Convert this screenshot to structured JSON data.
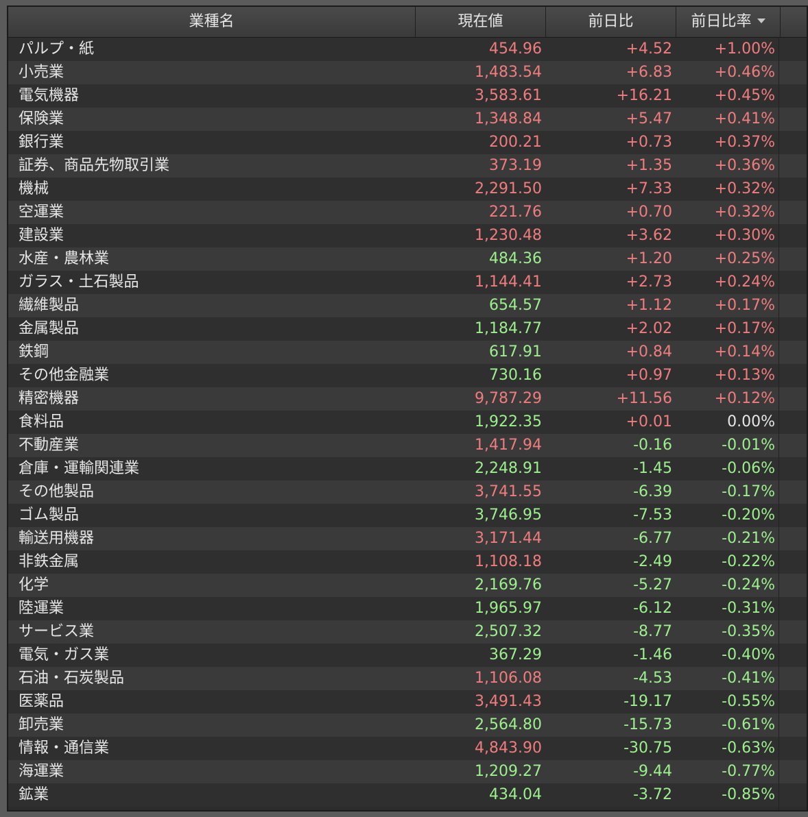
{
  "header": {
    "name": "業種名",
    "price": "現在値",
    "change": "前日比",
    "rate": "前日比率"
  },
  "colors": {
    "up": "#f07d7d",
    "down": "#9df08e",
    "flat": "#e6e6e6"
  },
  "rows": [
    {
      "name": "パルプ・紙",
      "price": "454.96",
      "price_dir": "up",
      "change": "+4.52",
      "change_dir": "up",
      "rate": "+1.00%",
      "rate_dir": "up"
    },
    {
      "name": "小売業",
      "price": "1,483.54",
      "price_dir": "up",
      "change": "+6.83",
      "change_dir": "up",
      "rate": "+0.46%",
      "rate_dir": "up"
    },
    {
      "name": "電気機器",
      "price": "3,583.61",
      "price_dir": "up",
      "change": "+16.21",
      "change_dir": "up",
      "rate": "+0.45%",
      "rate_dir": "up"
    },
    {
      "name": "保険業",
      "price": "1,348.84",
      "price_dir": "up",
      "change": "+5.47",
      "change_dir": "up",
      "rate": "+0.41%",
      "rate_dir": "up"
    },
    {
      "name": "銀行業",
      "price": "200.21",
      "price_dir": "up",
      "change": "+0.73",
      "change_dir": "up",
      "rate": "+0.37%",
      "rate_dir": "up"
    },
    {
      "name": "証券、商品先物取引業",
      "price": "373.19",
      "price_dir": "up",
      "change": "+1.35",
      "change_dir": "up",
      "rate": "+0.36%",
      "rate_dir": "up"
    },
    {
      "name": "機械",
      "price": "2,291.50",
      "price_dir": "up",
      "change": "+7.33",
      "change_dir": "up",
      "rate": "+0.32%",
      "rate_dir": "up"
    },
    {
      "name": "空運業",
      "price": "221.76",
      "price_dir": "up",
      "change": "+0.70",
      "change_dir": "up",
      "rate": "+0.32%",
      "rate_dir": "up"
    },
    {
      "name": "建設業",
      "price": "1,230.48",
      "price_dir": "up",
      "change": "+3.62",
      "change_dir": "up",
      "rate": "+0.30%",
      "rate_dir": "up"
    },
    {
      "name": "水産・農林業",
      "price": "484.36",
      "price_dir": "down",
      "change": "+1.20",
      "change_dir": "up",
      "rate": "+0.25%",
      "rate_dir": "up"
    },
    {
      "name": "ガラス・土石製品",
      "price": "1,144.41",
      "price_dir": "up",
      "change": "+2.73",
      "change_dir": "up",
      "rate": "+0.24%",
      "rate_dir": "up"
    },
    {
      "name": "繊維製品",
      "price": "654.57",
      "price_dir": "down",
      "change": "+1.12",
      "change_dir": "up",
      "rate": "+0.17%",
      "rate_dir": "up"
    },
    {
      "name": "金属製品",
      "price": "1,184.77",
      "price_dir": "down",
      "change": "+2.02",
      "change_dir": "up",
      "rate": "+0.17%",
      "rate_dir": "up"
    },
    {
      "name": "鉄鋼",
      "price": "617.91",
      "price_dir": "down",
      "change": "+0.84",
      "change_dir": "up",
      "rate": "+0.14%",
      "rate_dir": "up"
    },
    {
      "name": "その他金融業",
      "price": "730.16",
      "price_dir": "down",
      "change": "+0.97",
      "change_dir": "up",
      "rate": "+0.13%",
      "rate_dir": "up"
    },
    {
      "name": "精密機器",
      "price": "9,787.29",
      "price_dir": "up",
      "change": "+11.56",
      "change_dir": "up",
      "rate": "+0.12%",
      "rate_dir": "up"
    },
    {
      "name": "食料品",
      "price": "1,922.35",
      "price_dir": "down",
      "change": "+0.01",
      "change_dir": "up",
      "rate": "0.00%",
      "rate_dir": "flat"
    },
    {
      "name": "不動産業",
      "price": "1,417.94",
      "price_dir": "up",
      "change": "-0.16",
      "change_dir": "down",
      "rate": "-0.01%",
      "rate_dir": "down"
    },
    {
      "name": "倉庫・運輸関連業",
      "price": "2,248.91",
      "price_dir": "down",
      "change": "-1.45",
      "change_dir": "down",
      "rate": "-0.06%",
      "rate_dir": "down"
    },
    {
      "name": "その他製品",
      "price": "3,741.55",
      "price_dir": "up",
      "change": "-6.39",
      "change_dir": "down",
      "rate": "-0.17%",
      "rate_dir": "down"
    },
    {
      "name": "ゴム製品",
      "price": "3,746.95",
      "price_dir": "down",
      "change": "-7.53",
      "change_dir": "down",
      "rate": "-0.20%",
      "rate_dir": "down"
    },
    {
      "name": "輸送用機器",
      "price": "3,171.44",
      "price_dir": "up",
      "change": "-6.77",
      "change_dir": "down",
      "rate": "-0.21%",
      "rate_dir": "down"
    },
    {
      "name": "非鉄金属",
      "price": "1,108.18",
      "price_dir": "up",
      "change": "-2.49",
      "change_dir": "down",
      "rate": "-0.22%",
      "rate_dir": "down"
    },
    {
      "name": "化学",
      "price": "2,169.76",
      "price_dir": "down",
      "change": "-5.27",
      "change_dir": "down",
      "rate": "-0.24%",
      "rate_dir": "down"
    },
    {
      "name": "陸運業",
      "price": "1,965.97",
      "price_dir": "down",
      "change": "-6.12",
      "change_dir": "down",
      "rate": "-0.31%",
      "rate_dir": "down"
    },
    {
      "name": "サービス業",
      "price": "2,507.32",
      "price_dir": "down",
      "change": "-8.77",
      "change_dir": "down",
      "rate": "-0.35%",
      "rate_dir": "down"
    },
    {
      "name": "電気・ガス業",
      "price": "367.29",
      "price_dir": "down",
      "change": "-1.46",
      "change_dir": "down",
      "rate": "-0.40%",
      "rate_dir": "down"
    },
    {
      "name": "石油・石炭製品",
      "price": "1,106.08",
      "price_dir": "up",
      "change": "-4.53",
      "change_dir": "down",
      "rate": "-0.41%",
      "rate_dir": "down"
    },
    {
      "name": "医薬品",
      "price": "3,491.43",
      "price_dir": "up",
      "change": "-19.17",
      "change_dir": "down",
      "rate": "-0.55%",
      "rate_dir": "down"
    },
    {
      "name": "卸売業",
      "price": "2,564.80",
      "price_dir": "down",
      "change": "-15.73",
      "change_dir": "down",
      "rate": "-0.61%",
      "rate_dir": "down"
    },
    {
      "name": "情報・通信業",
      "price": "4,843.90",
      "price_dir": "up",
      "change": "-30.75",
      "change_dir": "down",
      "rate": "-0.63%",
      "rate_dir": "down"
    },
    {
      "name": "海運業",
      "price": "1,209.27",
      "price_dir": "down",
      "change": "-9.44",
      "change_dir": "down",
      "rate": "-0.77%",
      "rate_dir": "down"
    },
    {
      "name": "鉱業",
      "price": "434.04",
      "price_dir": "down",
      "change": "-3.72",
      "change_dir": "down",
      "rate": "-0.85%",
      "rate_dir": "down"
    }
  ]
}
